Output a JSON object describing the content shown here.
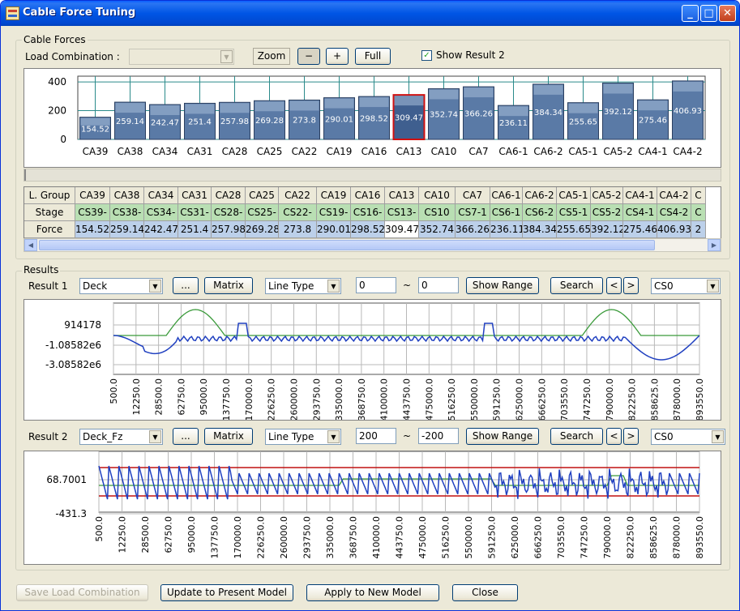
{
  "window": {
    "title": "Cable Force Tuning"
  },
  "cable_forces": {
    "group_label": "Cable Forces",
    "load_combination_label": "Load Combination :",
    "load_combination_value": "",
    "zoom_label": "Zoom",
    "zoom_out": "−",
    "zoom_in": "+",
    "full": "Full",
    "show_result2_label": "Show Result 2",
    "show_result2_checked": true
  },
  "chart_data": [
    {
      "type": "bar",
      "categories": [
        "CA39",
        "CA38",
        "CA34",
        "CA31",
        "CA28",
        "CA25",
        "CA22",
        "CA19",
        "CA16",
        "CA13",
        "CA10",
        "CA7",
        "CA6-1",
        "CA6-2",
        "CA5-1",
        "CA5-2",
        "CA4-1",
        "CA4-2"
      ],
      "values": [
        154.52,
        259.14,
        242.47,
        251.4,
        257.98,
        269.28,
        273.8,
        290.01,
        298.52,
        309.47,
        352.74,
        366.26,
        236.11,
        384.34,
        255.65,
        392.12,
        275.46,
        406.93
      ],
      "value_labels": [
        "154.52",
        "259.14",
        "242.47",
        "251.4",
        "257.98",
        "269.28",
        "273.8",
        "290.01",
        "298.52",
        "309.47",
        "352.74",
        "366.26",
        "236.11",
        "384.34",
        "255.65",
        "392.12",
        "275.46",
        "406.93"
      ],
      "selected": "CA13",
      "yticks": [
        "400",
        "200",
        "0"
      ],
      "ylim": [
        0,
        440
      ],
      "bar_color": "#5a7aa6",
      "selected_border": "#d01010"
    },
    {
      "type": "line",
      "name": "Result 1",
      "yticks": [
        "914178",
        "-1.08582e6",
        "-3.08582e6"
      ],
      "xticks": [
        "500.0",
        "12250.0",
        "28500.0",
        "62750.0",
        "95000.0",
        "137750.0",
        "170000.0",
        "226250.0",
        "260000.0",
        "293750.0",
        "335000.0",
        "368750.0",
        "410000.0",
        "443750.0",
        "475000.0",
        "516250.0",
        "550000.0",
        "591250.0",
        "625000.0",
        "666250.0",
        "703550.0",
        "747250.0",
        "790000.0",
        "822250.0",
        "858625.0",
        "878000.0",
        "893550.0"
      ],
      "series_colors": [
        "#2040c0",
        "#3a9a3a"
      ]
    },
    {
      "type": "line",
      "name": "Result 2",
      "yticks": [
        "68.7001",
        "-431.3"
      ],
      "xticks": [
        "500.0",
        "12250.0",
        "28500.0",
        "62750.0",
        "95000.0",
        "137750.0",
        "170000.0",
        "226250.0",
        "260000.0",
        "293750.0",
        "335000.0",
        "368750.0",
        "410000.0",
        "443750.0",
        "475000.0",
        "516250.0",
        "550000.0",
        "591250.0",
        "625000.0",
        "666250.0",
        "703550.0",
        "747250.0",
        "790000.0",
        "822250.0",
        "858625.0",
        "878000.0",
        "893550.0"
      ],
      "limit_lines": [
        200,
        -200
      ],
      "series_colors": [
        "#2040c0",
        "#3a9a3a",
        "#c01010"
      ]
    }
  ],
  "grid": {
    "row_headers": [
      "L. Group",
      "Stage",
      "Force"
    ],
    "groups": [
      "CA39",
      "CA38",
      "CA34",
      "CA31",
      "CA28",
      "CA25",
      "CA22",
      "CA19",
      "CA16",
      "CA13",
      "CA10",
      "CA7",
      "CA6-1",
      "CA6-2",
      "CA5-1",
      "CA5-2",
      "CA4-1",
      "CA4-2",
      "C"
    ],
    "stages": [
      "CS39-",
      "CS38-",
      "CS34-",
      "CS31-",
      "CS28-",
      "CS25-",
      "CS22-",
      "CS19-",
      "CS16-",
      "CS13-",
      "CS10",
      "CS7-1",
      "CS6-1",
      "CS6-2",
      "CS5-1",
      "CS5-2",
      "CS4-1",
      "CS4-2",
      "C"
    ],
    "forces": [
      "154.52",
      "259.14",
      "242.47",
      "251.4",
      "257.98",
      "269.28",
      "273.8",
      "290.01",
      "298.52",
      "309.47",
      "352.74",
      "366.26",
      "236.11",
      "384.34",
      "255.65",
      "392.12",
      "275.46",
      "406.93",
      "2"
    ],
    "selected_index": 9
  },
  "results": {
    "group_label": "Results",
    "result1": {
      "label": "Result 1",
      "type": "Deck",
      "dots": "...",
      "matrix": "Matrix",
      "line_type": "Line Type",
      "range_from": "0",
      "tilde": "~",
      "range_to": "0",
      "show_range": "Show Range",
      "search": "Search",
      "prev": "<",
      "next": ">",
      "stage": "CS0"
    },
    "result2": {
      "label": "Result 2",
      "type": "Deck_Fz",
      "dots": "...",
      "matrix": "Matrix",
      "line_type": "Line Type",
      "range_from": "200",
      "tilde": "~",
      "range_to": "-200",
      "show_range": "Show Range",
      "search": "Search",
      "prev": "<",
      "next": ">",
      "stage": "CS0"
    }
  },
  "footer": {
    "save": "Save Load Combination",
    "update": "Update to Present Model",
    "apply": "Apply to New Model",
    "close": "Close"
  }
}
